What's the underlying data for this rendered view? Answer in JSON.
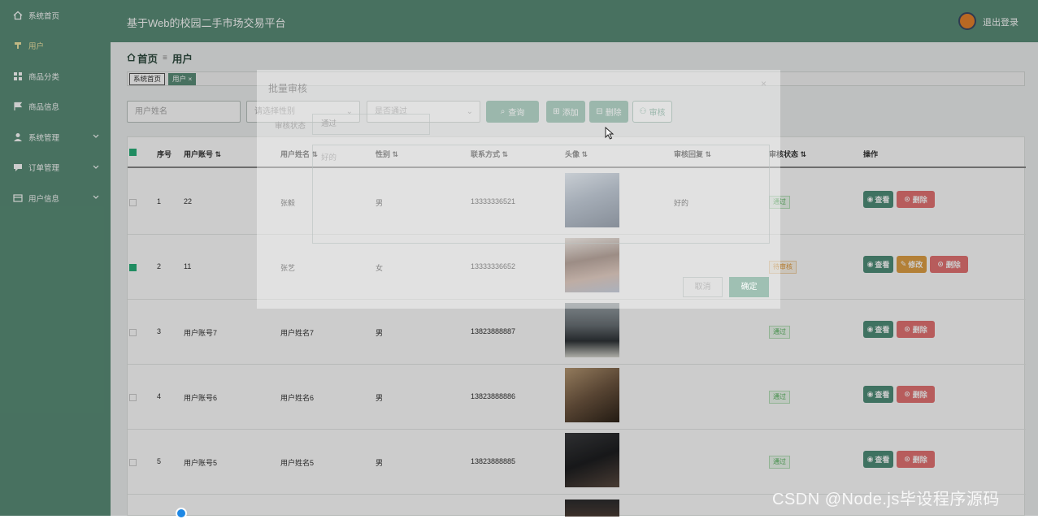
{
  "app": {
    "title": "基于Web的校园二手市场交易平台",
    "logout": "退出登录"
  },
  "sidebar": {
    "items": [
      {
        "label": "系统首页",
        "icon": "home-icon",
        "expand": false
      },
      {
        "label": "用户",
        "icon": "user-pin-icon",
        "expand": false
      },
      {
        "label": "商品分类",
        "icon": "grid-icon",
        "expand": false
      },
      {
        "label": "商品信息",
        "icon": "flag-icon",
        "expand": false
      },
      {
        "label": "系统管理",
        "icon": "person-icon",
        "expand": true
      },
      {
        "label": "订单管理",
        "icon": "comment-icon",
        "expand": true
      },
      {
        "label": "用户信息",
        "icon": "card-icon",
        "expand": true
      }
    ]
  },
  "breadcrumb": {
    "home": "首页",
    "current": "用户"
  },
  "tags": {
    "tag1": "系统首页",
    "tag2": "用户 ×"
  },
  "search": {
    "name_placeholder": "用户姓名",
    "gender_placeholder": "请选择性别",
    "pass_placeholder": "是否通过"
  },
  "toolbar": {
    "query": "查询",
    "add": "添加",
    "delete": "删除",
    "audit": "审核"
  },
  "table": {
    "headers": [
      "序号",
      "用户账号",
      "用户姓名",
      "性别",
      "联系方式",
      "头像",
      "审核回复",
      "审核状态",
      "操作"
    ],
    "rows": [
      {
        "no": "1",
        "account": "22",
        "name": "张毅",
        "gender": "男",
        "phone": "13333336521",
        "reply": "好的",
        "status": "通过",
        "checked": false
      },
      {
        "no": "2",
        "account": "11",
        "name": "张艺",
        "gender": "女",
        "phone": "13333336652",
        "reply": "",
        "status": "待审核",
        "checked": true
      },
      {
        "no": "3",
        "account": "用户账号7",
        "name": "用户姓名7",
        "gender": "男",
        "phone": "13823888887",
        "reply": "",
        "status": "通过",
        "checked": false
      },
      {
        "no": "4",
        "account": "用户账号6",
        "name": "用户姓名6",
        "gender": "男",
        "phone": "13823888886",
        "reply": "",
        "status": "通过",
        "checked": false
      },
      {
        "no": "5",
        "account": "用户账号5",
        "name": "用户姓名5",
        "gender": "男",
        "phone": "13823888885",
        "reply": "",
        "status": "通过",
        "checked": false
      }
    ],
    "actions": {
      "view": "查看",
      "edit": "修改",
      "delete": "删除"
    }
  },
  "dialog": {
    "title": "批量审核",
    "close": "×",
    "status_label": "审核状态",
    "status_value": "通过",
    "reply_text": "好的",
    "cancel": "取消",
    "ok": "确定"
  },
  "watermark": "CSDN @Node.js毕设程序源码",
  "colors": {
    "primary": "#5a8e78",
    "accent": "#6aa58e",
    "danger": "#e57373",
    "warning": "#e0a045",
    "success": "#53b25b"
  }
}
